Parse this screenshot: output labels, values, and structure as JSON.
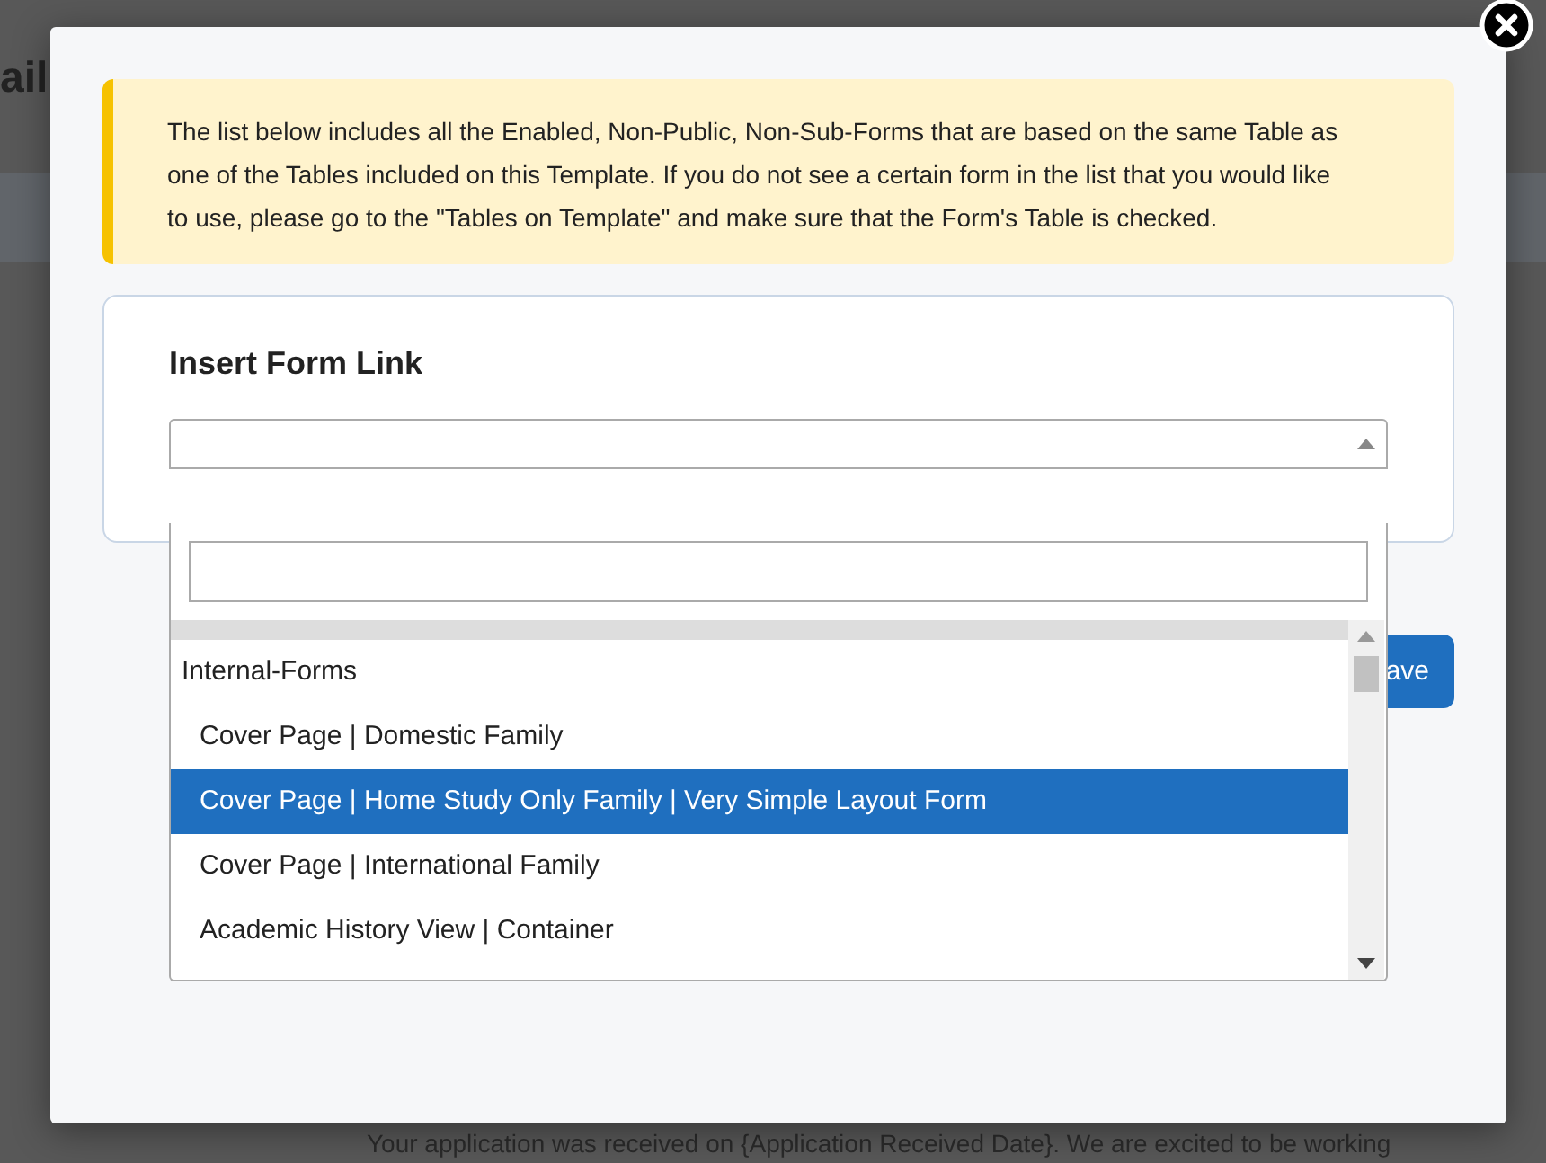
{
  "background_page": {
    "heading_fragment": "ail",
    "body_text": "Your application was received on {Application Received Date}.  We are excited to be working"
  },
  "dialog": {
    "notice": "The list below includes all the Enabled, Non-Public, Non-Sub-Forms that are based on the same Table as one of the Tables included on this Template. If you do not see a certain form in the list that you would like to use, please go to the \"Tables on Template\" and make sure that the Form's Table is checked.",
    "card_title": "Insert Form Link",
    "select": {
      "expanded": true
    },
    "groups": [
      {
        "label": "Internal-Forms",
        "options": [
          {
            "label": "Cover Page | Domestic Family",
            "selected": false
          },
          {
            "label": "Cover Page | Home Study Only Family | Very Simple Layout Form",
            "selected": true
          },
          {
            "label": "Cover Page | International Family",
            "selected": false
          },
          {
            "label": "Academic History View | Container",
            "selected": false
          }
        ]
      }
    ],
    "save_button": "ave"
  }
}
